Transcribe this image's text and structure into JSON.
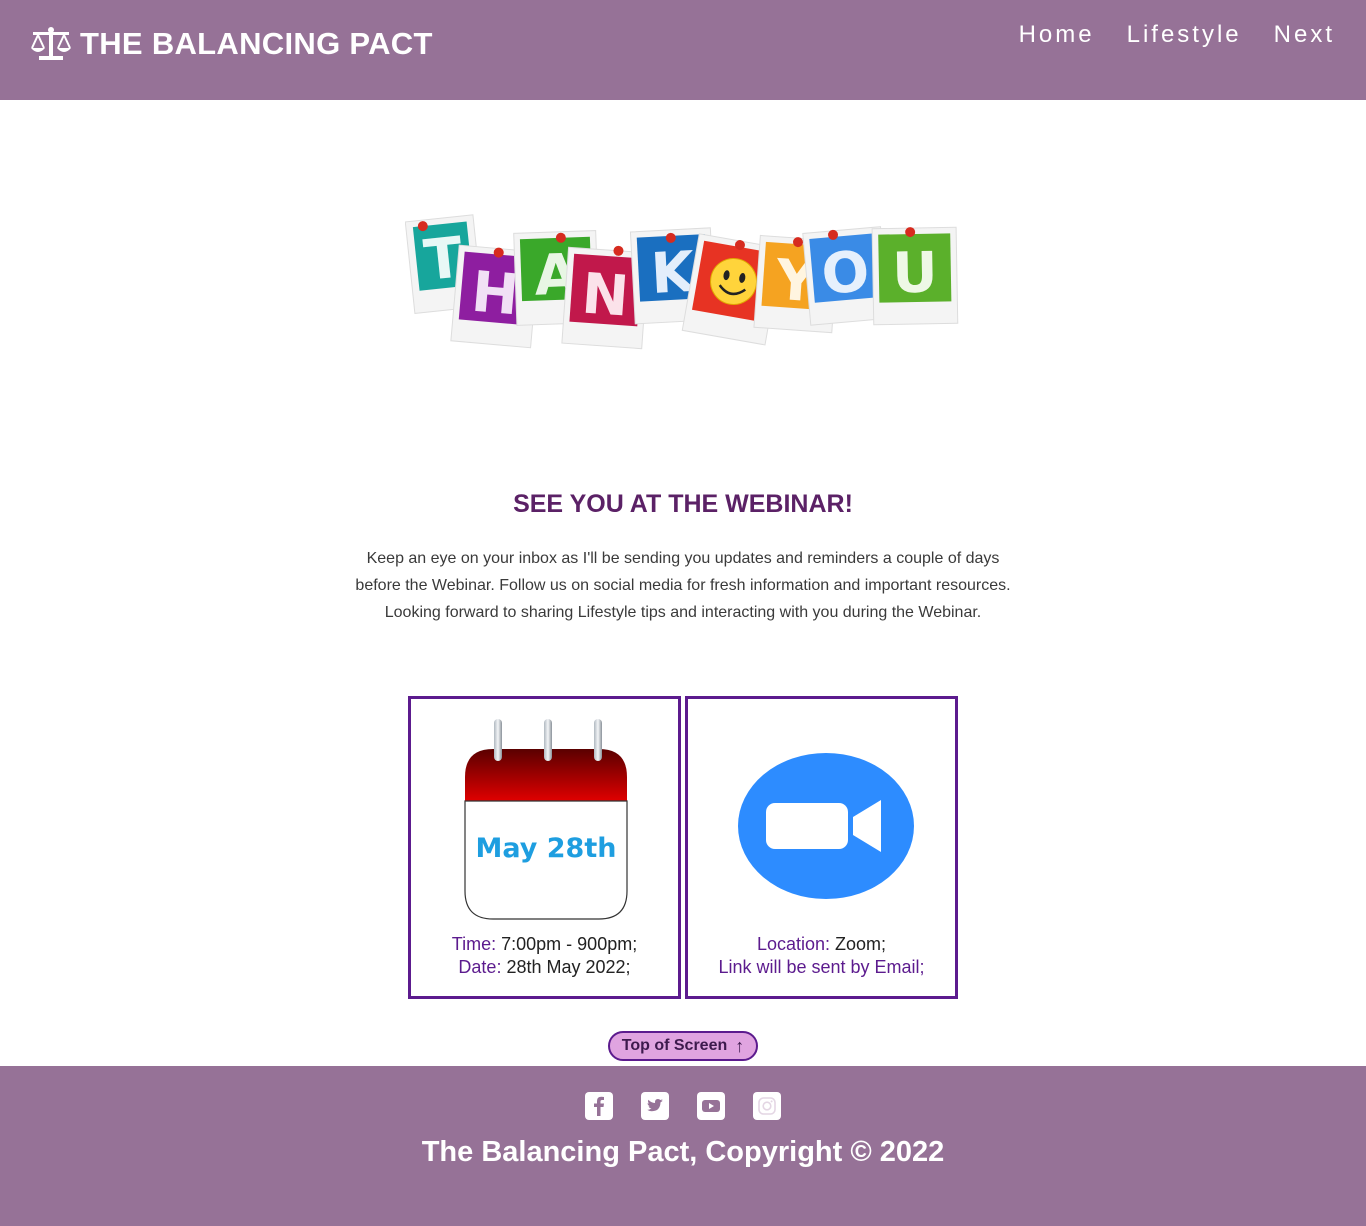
{
  "header": {
    "brand": "THE BALANCING PACT",
    "brand_icon": "balance-scale-icon",
    "nav": [
      "Home",
      "Lifestyle",
      "Next"
    ]
  },
  "hero": {
    "letters": [
      "T",
      "H",
      "A",
      "N",
      "K",
      "Y",
      "O",
      "U"
    ]
  },
  "main": {
    "heading": "SEE YOU AT THE WEBINAR!",
    "intro": "Keep an eye on your inbox as I'll be sending you updates and reminders a couple of days before the Webinar. Follow us on social media for fresh information and important resources. Looking forward to sharing Lifestyle tips and interacting with you during the Webinar."
  },
  "cards": {
    "date": {
      "calendar_text": "May 28th",
      "time_label": "Time:",
      "time_value": "7:00pm - 900pm;",
      "date_label": "Date:",
      "date_value": "28th May 2022;"
    },
    "zoom": {
      "icon": "video-camera-icon",
      "location_label": "Location:",
      "location_value": "Zoom;",
      "link_text": "Link will be sent by Email;"
    }
  },
  "top_button": {
    "label": "Top of Screen",
    "icon": "arrow-up-icon"
  },
  "footer": {
    "socials": [
      "facebook-icon",
      "twitter-icon",
      "youtube-icon",
      "instagram-icon"
    ],
    "copyright": "The Balancing Pact, Copyright © 2022"
  },
  "colors": {
    "header_bg": "#967297",
    "heading": "#5b2166",
    "card_border": "#5c1b8e",
    "button_bg": "#e0a4e0",
    "zoom_blue": "#2d8cff"
  }
}
